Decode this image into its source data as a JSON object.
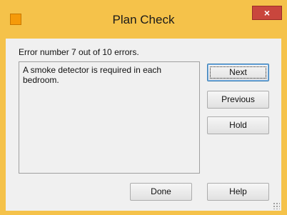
{
  "window": {
    "title": "Plan Check",
    "close_label": "×",
    "app_icon": "app-icon"
  },
  "status": {
    "text": "Error number 7 out of 10 errors."
  },
  "message": {
    "text": "A smoke detector is required in each bedroom."
  },
  "buttons": {
    "next": "Next",
    "previous": "Previous",
    "hold": "Hold",
    "done": "Done",
    "help": "Help"
  },
  "colors": {
    "titlebar": "#f5c24a",
    "close": "#c9463d",
    "client": "#f0f0f0"
  }
}
